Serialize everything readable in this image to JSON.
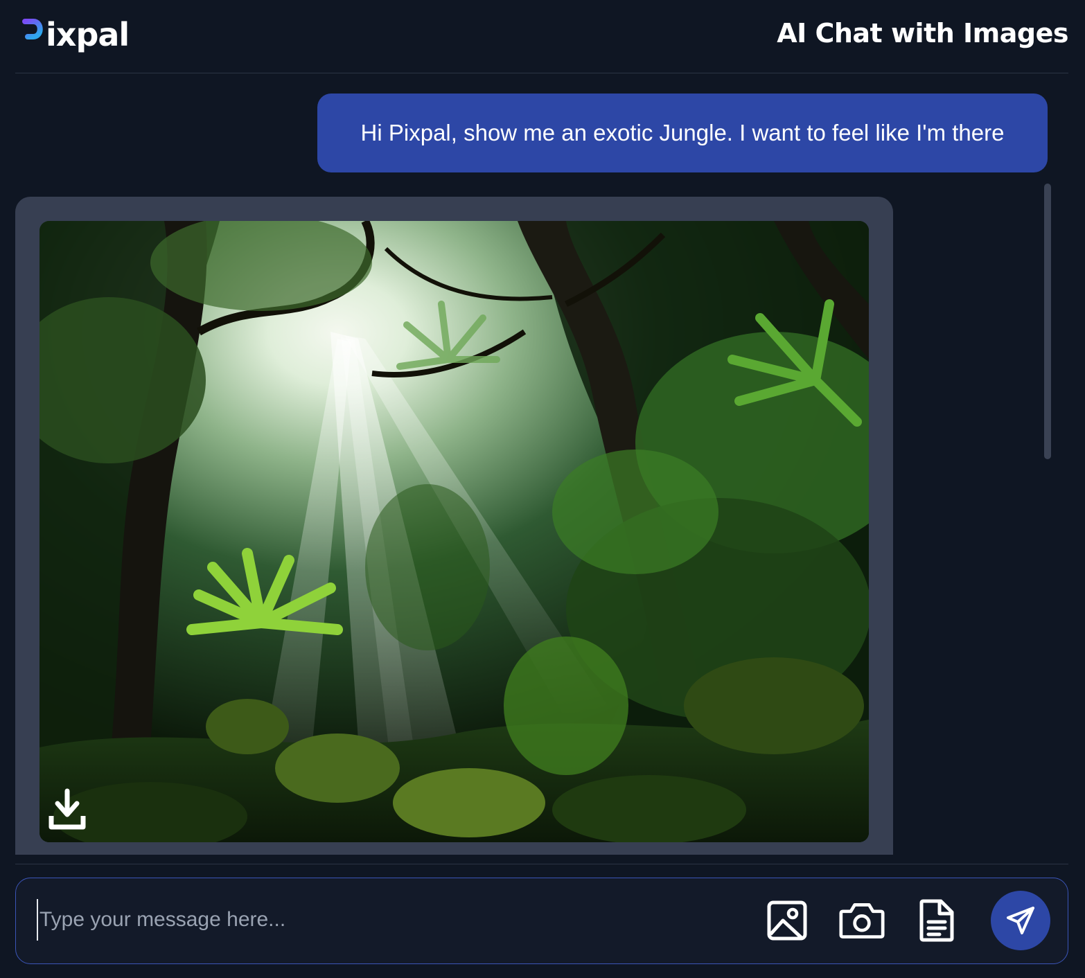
{
  "header": {
    "logo_text": "ixpal",
    "title": "AI Chat with Images"
  },
  "messages": [
    {
      "role": "user",
      "text": "Hi Pixpal, show me an exotic Jungle. I want to feel like I'm there"
    },
    {
      "role": "assistant",
      "type": "image",
      "image_subject": "sunlit exotic jungle with light rays, ferns, palms and mossy rocks",
      "download_icon": "download-icon"
    }
  ],
  "composer": {
    "placeholder": "Type your message here...",
    "value": "",
    "icons": [
      "image-upload-icon",
      "camera-icon",
      "document-icon",
      "send-icon"
    ]
  },
  "colors": {
    "background": "#0f1623",
    "user_bubble": "#2d47a6",
    "assistant_bubble": "#373f52",
    "send_button": "#2d47a6",
    "input_border": "#3b55b8",
    "logo_gradient": [
      "#7b4cf5",
      "#2fa7ee"
    ]
  }
}
